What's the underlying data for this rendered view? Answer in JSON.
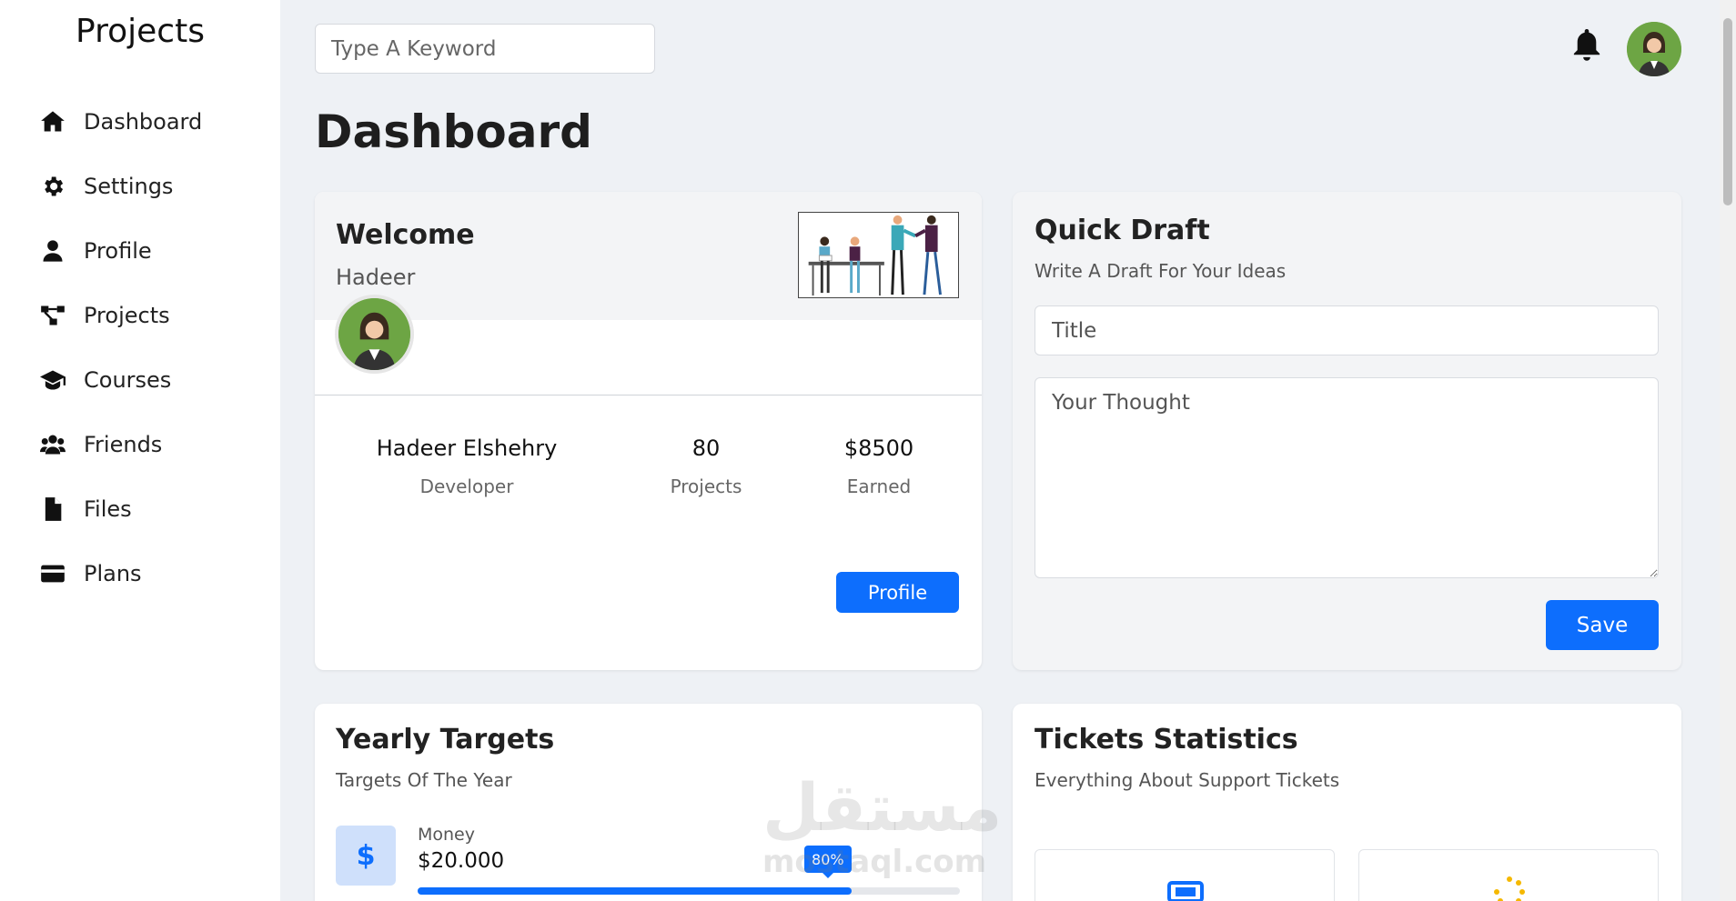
{
  "sidebar": {
    "brand": "Projects",
    "items": [
      {
        "label": "Dashboard",
        "icon": "home-icon"
      },
      {
        "label": "Settings",
        "icon": "gear-icon"
      },
      {
        "label": "Profile",
        "icon": "user-icon"
      },
      {
        "label": "Projects",
        "icon": "diagram-icon"
      },
      {
        "label": "Courses",
        "icon": "graduation-cap-icon"
      },
      {
        "label": "Friends",
        "icon": "users-icon"
      },
      {
        "label": "Files",
        "icon": "file-icon"
      },
      {
        "label": "Plans",
        "icon": "credit-card-icon"
      }
    ]
  },
  "header": {
    "search_placeholder": "Type A Keyword",
    "notification_icon": "bell-icon"
  },
  "page_title": "Dashboard",
  "welcome": {
    "title": "Welcome",
    "name": "Hadeer",
    "stats": [
      {
        "value": "Hadeer Elshehry",
        "label": "Developer"
      },
      {
        "value": "80",
        "label": "Projects"
      },
      {
        "value": "$8500",
        "label": "Earned"
      }
    ],
    "button": "Profile"
  },
  "quick_draft": {
    "title": "Quick Draft",
    "subtitle": "Write A Draft For Your Ideas",
    "title_placeholder": "Title",
    "thought_placeholder": "Your Thought",
    "save_button": "Save"
  },
  "yearly_targets": {
    "title": "Yearly Targets",
    "subtitle": "Targets Of The Year",
    "money_label": "Money",
    "money_value": "$20.000",
    "money_progress_label": "80%",
    "money_progress": 0.8
  },
  "tickets": {
    "title": "Tickets Statistics",
    "subtitle": "Everything About Support Tickets"
  },
  "watermark": {
    "arabic": "مستقل",
    "site": "mostaql.com"
  },
  "colors": {
    "accent": "#0d6efd",
    "background": "#eef1f5",
    "card": "#ffffff"
  }
}
